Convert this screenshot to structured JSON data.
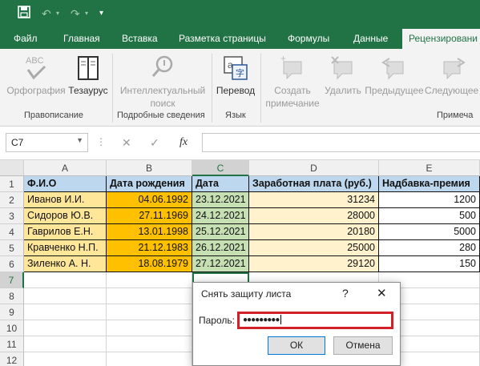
{
  "colors": {
    "brand": "#217346",
    "header_fill": "#bdd7ee",
    "name_fill": "#ffe699",
    "birth_fill": "#ffc000",
    "date_fill": "#c6e0b4",
    "value_fill": "#fff2cc",
    "highlight": "#d0202a"
  },
  "qat": {
    "icons": [
      "save-icon",
      "undo-icon",
      "redo-icon",
      "customize-icon"
    ]
  },
  "tabs": [
    "Файл",
    "Главная",
    "Вставка",
    "Разметка страницы",
    "Формулы",
    "Данные",
    "Рецензировани"
  ],
  "ribbon": {
    "spelling": "Орфография",
    "thesaurus": "Тезаурус",
    "smart_lookup": [
      "Интеллектуальный",
      "поиск"
    ],
    "translate": "Перевод",
    "new_comment": [
      "Создать",
      "примечание"
    ],
    "delete": "Удалить",
    "previous": "Предыдущее",
    "next": "Следующее",
    "groups": [
      "Правописание",
      "Подробные сведения",
      "Язык",
      "Примеча"
    ]
  },
  "formula_bar": {
    "name_box": "C7",
    "fx": "fx",
    "value": ""
  },
  "sheet": {
    "columns": [
      "A",
      "B",
      "C",
      "D",
      "E"
    ],
    "selected_column": "C",
    "rows": [
      "1",
      "2",
      "3",
      "4",
      "5",
      "6",
      "7",
      "8",
      "9",
      "10",
      "11",
      "12"
    ],
    "selected_row": "7",
    "data": [
      [
        "Ф.И.О",
        "Дата рождения",
        "Дата",
        "Заработная плата (руб.)",
        "Надбавка-премия"
      ],
      [
        "Иванов И.И.",
        "04.06.1992",
        "23.12.2021",
        "31234",
        "1200"
      ],
      [
        "Сидоров Ю.В.",
        "27.11.1969",
        "24.12.2021",
        "28000",
        "500"
      ],
      [
        "Гаврилов Е.Н.",
        "13.01.1998",
        "25.12.2021",
        "20180",
        "5000"
      ],
      [
        "Кравченко Н.П.",
        "21.12.1983",
        "26.12.2021",
        "25000",
        "280"
      ],
      [
        "Зиленко А. Н.",
        "18.08.1979",
        "27.12.2021",
        "29120",
        "150"
      ]
    ]
  },
  "dialog": {
    "title": "Снять защиту листа",
    "help": "?",
    "close": "✕",
    "label": "Пароль:",
    "password": "●●●●●●●●●",
    "ok": "ОК",
    "cancel": "Отмена"
  }
}
